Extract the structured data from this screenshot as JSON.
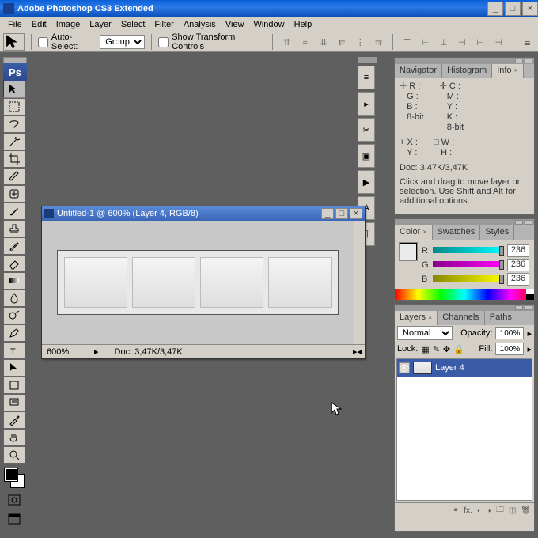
{
  "app": {
    "title": "Adobe Photoshop CS3 Extended"
  },
  "menu": [
    "File",
    "Edit",
    "Image",
    "Layer",
    "Select",
    "Filter",
    "Analysis",
    "View",
    "Window",
    "Help"
  ],
  "opt": {
    "autoselect_label": "Auto-Select:",
    "autoselect_value": "Group",
    "showtransform": "Show Transform Controls"
  },
  "doc": {
    "title": "Untitled-1 @ 600% (Layer 4, RGB/8)",
    "zoom": "600%",
    "docsize": "Doc: 3,47K/3,47K"
  },
  "info": {
    "r": "R :",
    "g": "G :",
    "b": "B :",
    "c": "C :",
    "m": "M :",
    "y": "Y :",
    "k": "K :",
    "bit": "8-bit",
    "x": "X :",
    "yy": "Y :",
    "w": "W :",
    "h": "H :",
    "docline": "Doc: 3,47K/3,47K",
    "hint": "Click and drag to move layer or selection. Use Shift and Alt for additional options."
  },
  "tabs": {
    "nav": "Navigator",
    "hist": "Histogram",
    "info": "Info",
    "color": "Color",
    "swatch": "Swatches",
    "styles": "Styles",
    "layers": "Layers",
    "channels": "Channels",
    "paths": "Paths"
  },
  "color": {
    "r": "R",
    "g": "G",
    "b": "B",
    "val": "236"
  },
  "layers": {
    "blend": "Normal",
    "opacity_lbl": "Opacity:",
    "opacity": "100%",
    "lock_lbl": "Lock:",
    "fill_lbl": "Fill:",
    "fill": "100%",
    "name": "Layer 4"
  }
}
